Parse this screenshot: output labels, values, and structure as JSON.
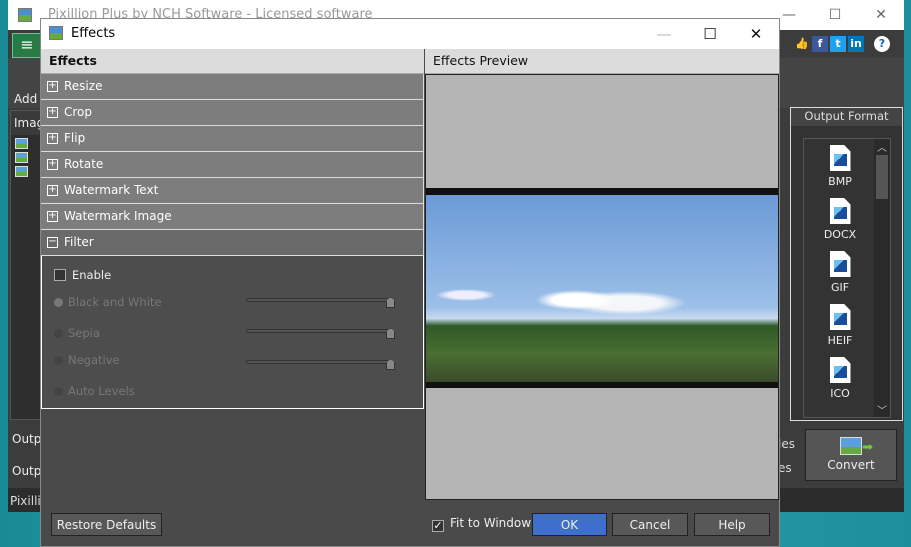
{
  "app": {
    "title": "Pixillion Plus by NCH Software - Licensed software",
    "add_label": "Add F",
    "images_header": "Imag",
    "output_label_1": "Outpu",
    "output_label_2": "Outpu",
    "status": "Pixilli",
    "files_1": "les",
    "files_2": "es",
    "output_format": {
      "title": "Output Format",
      "formats": [
        "BMP",
        "DOCX",
        "GIF",
        "HEIF",
        "ICO"
      ]
    },
    "convert_label": "Convert"
  },
  "dialog": {
    "title": "Effects",
    "left": {
      "header": "Effects",
      "sections": [
        "Resize",
        "Crop",
        "Flip",
        "Rotate",
        "Watermark Text",
        "Watermark Image",
        "Filter"
      ],
      "filter": {
        "enable_label": "Enable",
        "enabled": false,
        "options": [
          {
            "label": "Black and White",
            "selected": true,
            "slider": 100
          },
          {
            "label": "Sepia",
            "selected": false,
            "slider": 100
          },
          {
            "label": "Negative",
            "selected": false,
            "slider": 100
          },
          {
            "label": "Auto Levels",
            "selected": false
          }
        ]
      }
    },
    "right": {
      "header": "Effects Preview"
    },
    "footer": {
      "restore": "Restore Defaults",
      "fit_label": "Fit to Window",
      "fit_checked": true,
      "ok": "OK",
      "cancel": "Cancel",
      "help": "Help"
    }
  },
  "colors": {
    "ok_button": "#3f6fcc",
    "menu_button": "#2a7a45"
  }
}
